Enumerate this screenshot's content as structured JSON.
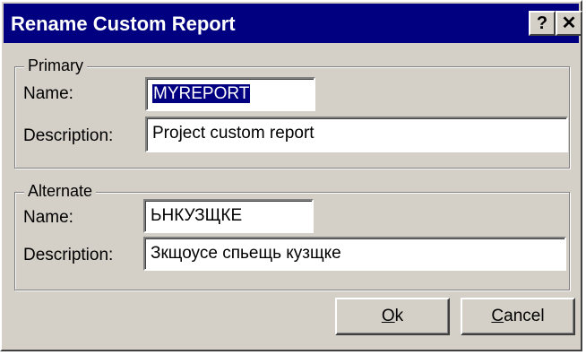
{
  "window": {
    "title": "Rename Custom Report",
    "help_label": "?",
    "close_label": "✕"
  },
  "primary": {
    "legend": "Primary",
    "name_label": "Name:",
    "name_value": "MYREPORT",
    "description_label": "Description:",
    "description_value": "Project custom report"
  },
  "alternate": {
    "legend": "Alternate",
    "name_label": "Name:",
    "name_value": "ЬНКУЗЩКЕ",
    "description_label": "Description:",
    "description_value": "Зкщоусе спьещь кузщке"
  },
  "buttons": {
    "ok_accel": "O",
    "ok_rest": "k",
    "cancel_accel": "C",
    "cancel_rest": "ancel"
  },
  "colors": {
    "titlebar": "#000080",
    "face": "#d4d0c8",
    "selection": "#000080"
  }
}
